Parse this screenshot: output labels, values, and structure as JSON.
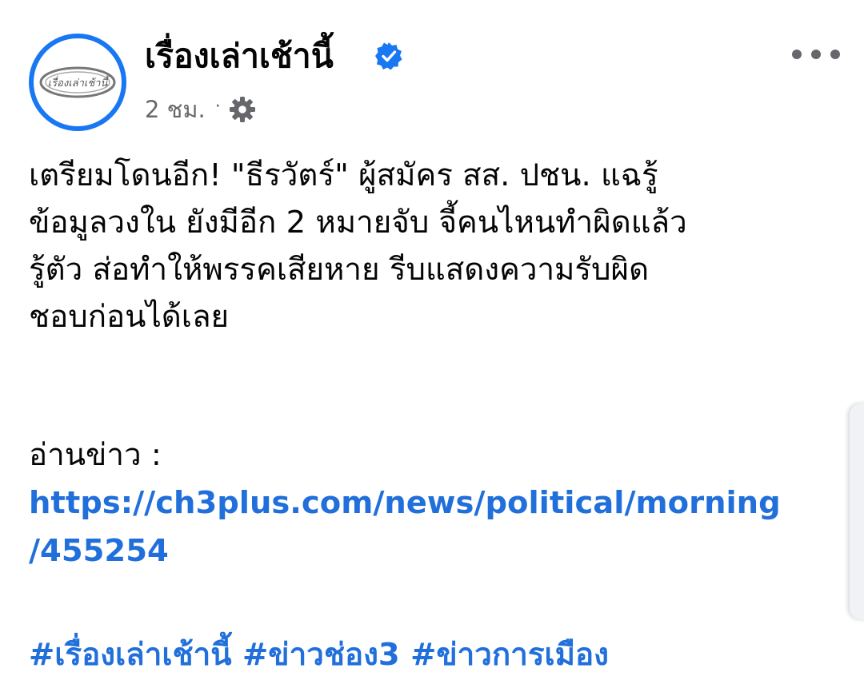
{
  "post": {
    "page_name": "เรื่องเล่าเช้านี้",
    "logo_text": "เรื่องเล่าเช้านี้",
    "time": "2 ชม.",
    "separator": "·",
    "body_lines": [
      "เตรียมโดนอีก! \"ธีรวัตร์\" ผู้สมัคร สส. ปชน. แฉรู้",
      "ข้อมูลวงใน ยังมีอีก 2 หมายจับ จี้คนไหนทำผิดแล้ว",
      "รู้ตัว ส่อทำให้พรรคเสียหาย รีบแสดงความรับผิด",
      "ชอบก่อนได้เลย"
    ],
    "read_label": "อ่านข่าว :",
    "link_lines": [
      "https://ch3plus.com/news/political/morning",
      "/455254"
    ],
    "hashtags": [
      "#เรื่องเล่าเช้านี้",
      "#ข่าวช่อง3",
      "#ข่าวการเมือง"
    ]
  },
  "icons": {
    "verified": "verified-badge-icon",
    "audience": "gear-icon",
    "more": "more-options-icon"
  },
  "colors": {
    "brand_blue": "#1877f2",
    "link_blue": "#216fdb",
    "meta_gray": "#65676b",
    "text": "#050505"
  }
}
